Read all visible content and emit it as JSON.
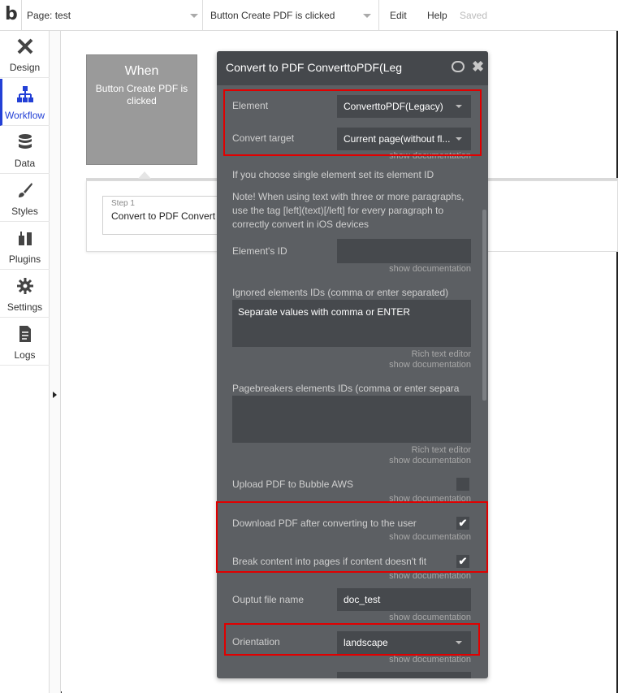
{
  "topbar": {
    "page_label": "Page: test",
    "event_label": "Button Create PDF is clicked",
    "edit": "Edit",
    "help": "Help",
    "saved": "Saved"
  },
  "sidebar": {
    "items": [
      {
        "label": "Design",
        "icon": "design-icon"
      },
      {
        "label": "Workflow",
        "icon": "workflow-icon"
      },
      {
        "label": "Data",
        "icon": "database-icon"
      },
      {
        "label": "Styles",
        "icon": "brush-icon"
      },
      {
        "label": "Plugins",
        "icon": "plugin-icon"
      },
      {
        "label": "Settings",
        "icon": "gear-icon"
      },
      {
        "label": "Logs",
        "icon": "document-icon"
      }
    ],
    "active": "Workflow"
  },
  "canvas": {
    "when_title": "When",
    "when_desc": "Button Create PDF is clicked",
    "step_num": "Step 1",
    "step_name": "Convert to PDF Convert"
  },
  "panel": {
    "title": "Convert to PDF ConverttoPDF(Leg",
    "element_label": "Element",
    "element_value": "ConverttoPDF(Legacy)",
    "target_label": "Convert target",
    "target_value": "Current page(without fl...",
    "show_doc": "show documentation",
    "single_note": "If you choose single element set its element ID",
    "note": "Note! When using text with three or more paragraphs, use the tag [left](text)[/left] for every paragraph to correctly convert in iOS devices",
    "element_id_label": "Element's ID",
    "element_id_value": "",
    "ignored_label": "Ignored elements IDs (comma or enter separated)",
    "ignored_placeholder": "Separate values with comma or ENTER",
    "rich_text": "Rich text editor",
    "pagebreakers_label": "Pagebreakers elements IDs (comma or enter separa",
    "upload_label": "Upload PDF to Bubble AWS",
    "upload_checked": false,
    "download_label": "Download PDF after converting to the user",
    "download_checked": true,
    "break_label": "Break content into pages if content doesn't fit",
    "break_checked": true,
    "filename_label": "Ouptut file name",
    "filename_value": "doc_test",
    "orientation_label": "Orientation",
    "orientation_value": "landscape",
    "check_mark": "✔"
  },
  "colors": {
    "accent": "#2340d6",
    "panel_bg": "#5c5f63",
    "highlight": "#e00000"
  }
}
